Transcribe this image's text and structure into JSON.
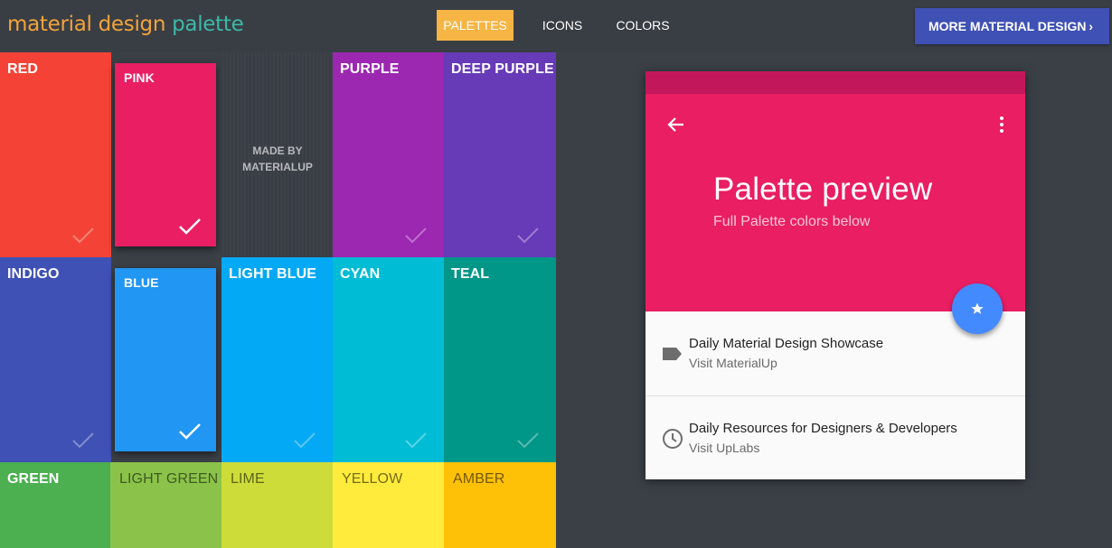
{
  "logo": {
    "part1": "material design",
    "part2": "palette"
  },
  "nav": {
    "palettes": "PALETTES",
    "icons": "ICONS",
    "colors": "COLORS"
  },
  "more_button": {
    "label": "MORE MATERIAL DESIGN",
    "chevron": "›"
  },
  "made_by": {
    "line1": "MADE BY",
    "line2": "MATERIALUP"
  },
  "tiles": {
    "red": {
      "name": "RED",
      "color": "#f44336"
    },
    "pink": {
      "name": "PINK",
      "color": "#e91e63",
      "selected": true
    },
    "purple": {
      "name": "PURPLE",
      "color": "#9c27b0"
    },
    "deep_purple": {
      "name": "DEEP PURPLE",
      "color": "#673ab7"
    },
    "indigo": {
      "name": "INDIGO",
      "color": "#3f51b5"
    },
    "blue": {
      "name": "BLUE",
      "color": "#2196f3",
      "selected": true
    },
    "light_blue": {
      "name": "LIGHT BLUE",
      "color": "#03a9f4"
    },
    "cyan": {
      "name": "CYAN",
      "color": "#00bcd4"
    },
    "teal": {
      "name": "TEAL",
      "color": "#009688"
    },
    "green": {
      "name": "GREEN",
      "color": "#4caf50"
    },
    "light_green": {
      "name": "LIGHT GREEN",
      "color": "#8bc34a"
    },
    "lime": {
      "name": "LIME",
      "color": "#cddc39"
    },
    "yellow": {
      "name": "YELLOW",
      "color": "#ffeb3b"
    },
    "amber": {
      "name": "AMBER",
      "color": "#ffc107"
    }
  },
  "preview": {
    "title": "Palette preview",
    "subtitle": "Full Palette colors below",
    "primary_color": "#e91e63",
    "dark_color": "#c2185b",
    "accent_color": "#448aff",
    "icons": {
      "back": "arrow-back-icon",
      "menu": "more-vert-icon",
      "fab": "star-icon"
    },
    "items": [
      {
        "title": "Daily Material Design Showcase",
        "subtitle": "Visit MaterialUp",
        "icon": "label-icon"
      },
      {
        "title": "Daily Resources for Designers & Developers",
        "subtitle": "Visit UpLabs",
        "icon": "clock-icon"
      }
    ]
  }
}
